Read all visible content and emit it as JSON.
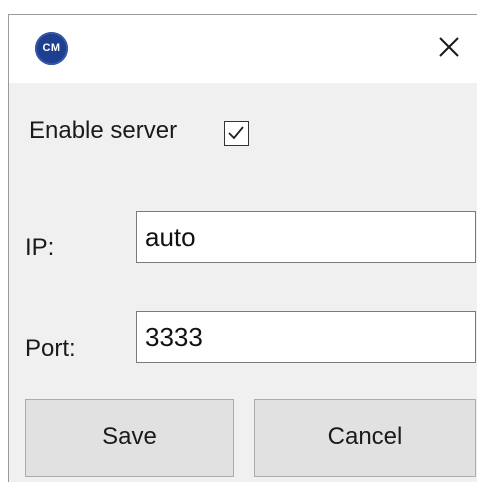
{
  "window": {
    "app_icon_text": "CM",
    "app_icon_name": "cm-logo-icon",
    "close_icon_name": "close-icon"
  },
  "form": {
    "enable_server_label": "Enable server",
    "enable_server_checked": true,
    "ip_label": "IP:",
    "ip_value": "auto",
    "port_label": "Port:",
    "port_value": "3333"
  },
  "buttons": {
    "save_label": "Save",
    "cancel_label": "Cancel"
  },
  "colors": {
    "app_icon_bg": "#1e3f8f",
    "dialog_bg": "#f0f0f0",
    "button_bg": "#e1e1e1"
  }
}
